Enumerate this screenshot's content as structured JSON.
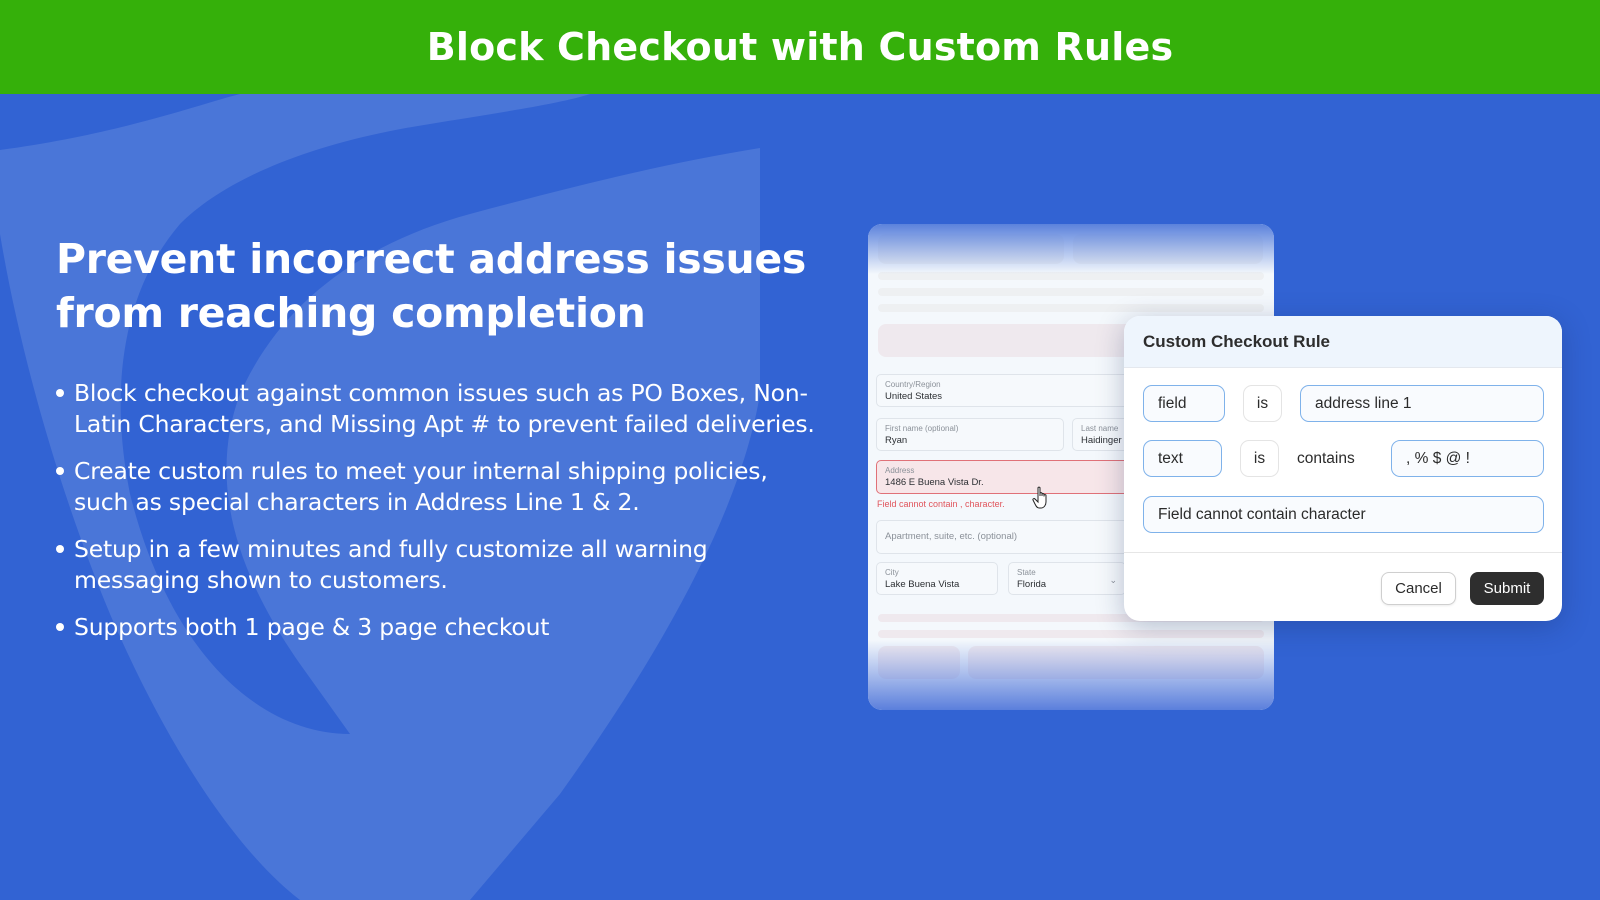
{
  "header": {
    "title": "Block Checkout with Custom Rules"
  },
  "colors": {
    "header_bg": "#35b00a",
    "page_bg": "#3263d3",
    "error": "#e0555c",
    "submit_bg": "#2e2e2e"
  },
  "main": {
    "headline": "Prevent incorrect address issues from reaching completion",
    "bullets": [
      "Block checkout against common issues such as PO Boxes, Non-Latin Characters, and Missing Apt # to prevent failed deliveries.",
      "Create custom rules to meet your internal shipping policies, such as special characters in Address Line 1 & 2.",
      "Setup in a few minutes and fully customize all warning messaging shown to customers.",
      "Supports both 1 page & 3 page checkout"
    ]
  },
  "checkout_form": {
    "country": {
      "label": "Country/Region",
      "value": "United States"
    },
    "first_name": {
      "label": "First name (optional)",
      "value": "Ryan"
    },
    "last_name": {
      "label": "Last name",
      "value": "Haidinger"
    },
    "address": {
      "label": "Address",
      "value": "1486 E Buena Vista Dr."
    },
    "address_error": "Field cannot contain , character.",
    "apartment": {
      "placeholder": "Apartment, suite, etc. (optional)"
    },
    "city": {
      "label": "City",
      "value": "Lake Buena Vista"
    },
    "state": {
      "label": "State",
      "value": "Florida"
    }
  },
  "modal": {
    "title": "Custom Checkout Rule",
    "row1": {
      "subject": "field",
      "operator": "is",
      "value": "address line 1"
    },
    "row2": {
      "subject": "text",
      "operator": "is",
      "condition": "contains",
      "value": ", % $ @ !"
    },
    "message": "Field cannot contain character",
    "cancel_label": "Cancel",
    "submit_label": "Submit"
  }
}
